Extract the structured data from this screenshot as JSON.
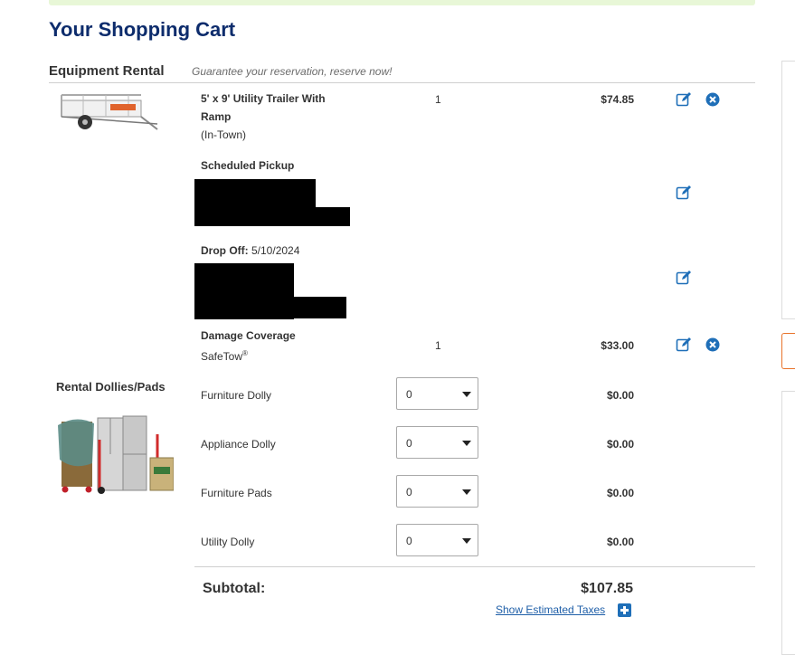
{
  "page_title": "Your Shopping Cart",
  "equipment_section": {
    "title": "Equipment Rental",
    "subtitle": "Guarantee your reservation, reserve now!"
  },
  "trailer": {
    "name": "5' x 9' Utility Trailer With Ramp",
    "type": "(In-Town)",
    "qty": "1",
    "price": "$74.85",
    "image_icon": "utility-trailer-image"
  },
  "pickup": {
    "label": "Scheduled Pickup"
  },
  "dropoff": {
    "label": "Drop Off:",
    "date": "5/10/2024"
  },
  "damage": {
    "label": "Damage Coverage",
    "product": "SafeTow",
    "product_mark": "®",
    "qty": "1",
    "price": "$33.00"
  },
  "dollies_section": {
    "title": "Rental Dollies/Pads",
    "image_icon": "dollies-pads-image",
    "items": [
      {
        "name": "Furniture Dolly",
        "qty": "0",
        "price": "$0.00"
      },
      {
        "name": "Appliance Dolly",
        "qty": "0",
        "price": "$0.00"
      },
      {
        "name": "Furniture Pads",
        "qty": "0",
        "price": "$0.00"
      },
      {
        "name": "Utility Dolly",
        "qty": "0",
        "price": "$0.00"
      }
    ]
  },
  "subtotal": {
    "label": "Subtotal:",
    "value": "$107.85"
  },
  "taxes_link": "Show Estimated Taxes",
  "colors": {
    "title_navy": "#0d2c6c",
    "icon_blue": "#1f6fb8",
    "link_blue": "#1f5fa8",
    "success_bar": "#e8f7d7",
    "side_orange": "#e8732a"
  },
  "icons": [
    "edit-icon",
    "remove-icon",
    "chevron-down-icon",
    "plus-icon"
  ]
}
